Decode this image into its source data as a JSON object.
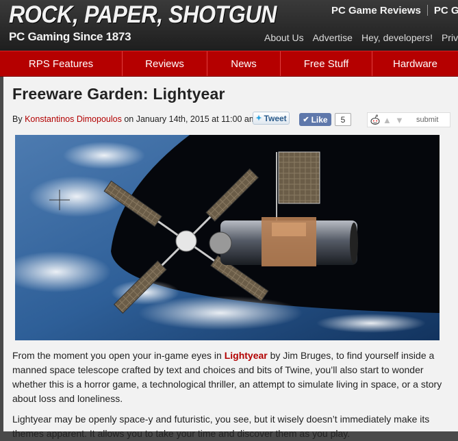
{
  "site": {
    "logo": "ROCK, PAPER, SHOTGUN",
    "tagline": "PC Gaming Since 1873",
    "top_links": [
      "PC Game Reviews",
      "PC G"
    ],
    "sub_links": [
      "About Us",
      "Advertise",
      "Hey, developers!",
      "Priv"
    ]
  },
  "nav": {
    "items": [
      "RPS Features",
      "Reviews",
      "News",
      "Free Stuff",
      "Hardware"
    ]
  },
  "article": {
    "title": "Freeware Garden: Lightyear",
    "byline_prefix": "By",
    "author": "Konstantinos Dimopoulos",
    "byline_suffix": "on January 14th, 2015 at 11:00 am.",
    "tweet_label": "Tweet",
    "like_label": "Like",
    "like_count": "5",
    "reddit_submit": "submit",
    "hero_alt": "space station in orbit above Earth",
    "para1_before": "From the moment you open your in-game eyes in",
    "para1_link": "Lightyear",
    "para1_after": "by Jim Bruges, to find yourself inside a manned space telescope crafted by text and choices and bits of Twine, you’ll also start to wonder whether this is a horror game, a technological thriller, an attempt to simulate living in space, or a story about loss and loneliness.",
    "para2": "Lightyear may be openly space-y and futuristic, you see, but it wisely doesn’t immediately make its themes apparent. It allows you to take your time and discover them as you play."
  },
  "colors": {
    "header_bg": "#2a2a2a",
    "nav_red": "#b50000",
    "link_red": "#b20000",
    "content_bg": "#f2f2f2"
  }
}
